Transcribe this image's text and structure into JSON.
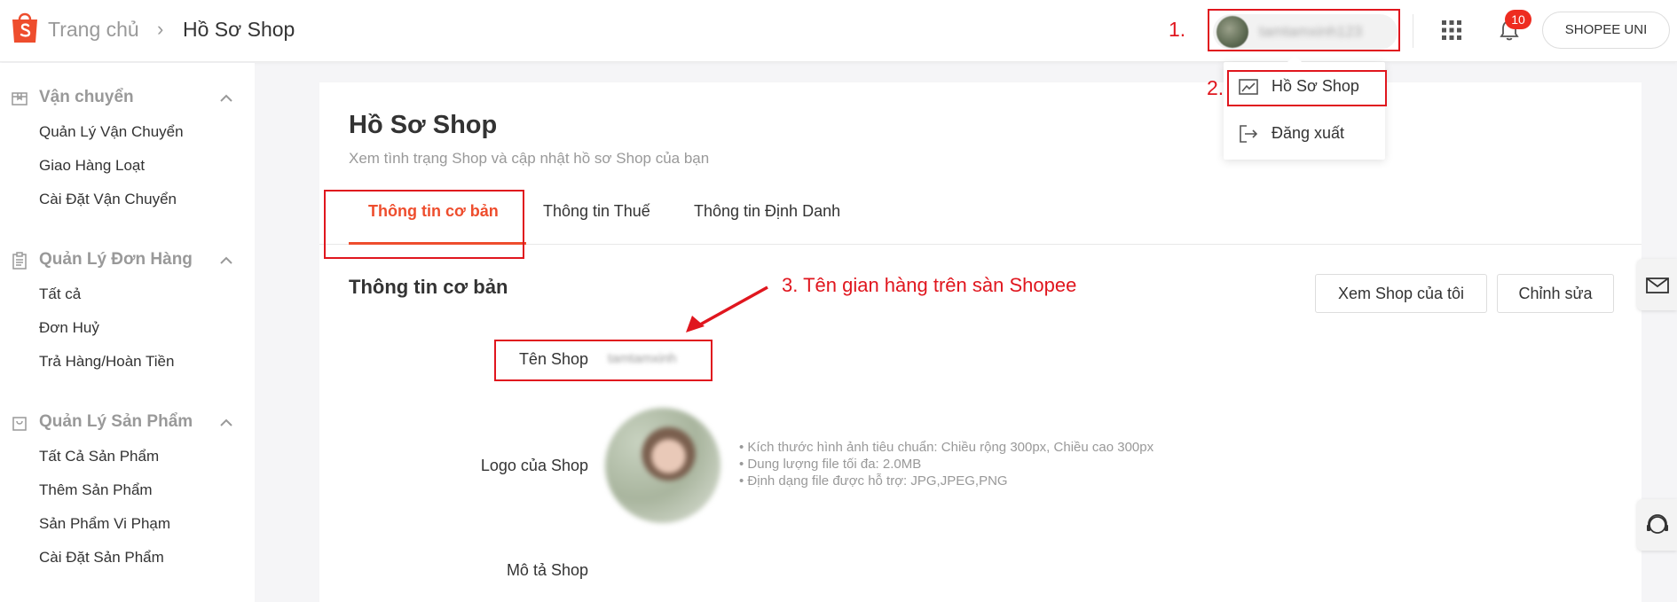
{
  "header": {
    "breadcrumb_home": "Trang chủ",
    "breadcrumb_separator": "›",
    "breadcrumb_current": "Hồ Sơ Shop",
    "user_name": "tamtamxinh123",
    "notification_count": "10",
    "uni_button": "SHOPEE UNI"
  },
  "user_menu": {
    "items": [
      {
        "label": "Hồ Sơ Shop",
        "icon": "shop-profile-icon"
      },
      {
        "label": "Đăng xuất",
        "icon": "logout-icon"
      }
    ]
  },
  "sidebar": {
    "sections": [
      {
        "title": "Vận chuyển",
        "icon": "shipping-box-icon",
        "items": [
          "Quản Lý Vận Chuyển",
          "Giao Hàng Loạt",
          "Cài Đặt Vận Chuyển"
        ]
      },
      {
        "title": "Quản Lý Đơn Hàng",
        "icon": "clipboard-icon",
        "items": [
          "Tất cả",
          "Đơn Huỷ",
          "Trả Hàng/Hoàn Tiền"
        ]
      },
      {
        "title": "Quản Lý Sản Phẩm",
        "icon": "bag-icon",
        "items": [
          "Tất Cả Sản Phẩm",
          "Thêm Sản Phẩm",
          "Sản Phẩm Vi Phạm",
          "Cài Đặt Sản Phẩm"
        ]
      }
    ]
  },
  "main": {
    "title": "Hồ Sơ Shop",
    "subtitle": "Xem tình trạng Shop và cập nhật hồ sơ Shop của bạn",
    "tabs": [
      {
        "label": "Thông tin cơ bản",
        "active": true
      },
      {
        "label": "Thông tin Thuế",
        "active": false
      },
      {
        "label": "Thông tin Định Danh",
        "active": false
      }
    ],
    "section_title": "Thông tin cơ bản",
    "view_shop_button": "Xem Shop của tôi",
    "edit_button": "Chỉnh sửa",
    "fields": {
      "shop_name_label": "Tên Shop",
      "shop_name_value": "tamtamxinh",
      "logo_label": "Logo của Shop",
      "logo_hints": [
        "• Kích thước hình ảnh tiêu chuẩn: Chiều rộng 300px, Chiều cao 300px",
        "• Dung lượng file tối đa: 2.0MB",
        "• Định dạng file được hỗ trợ: JPG,JPEG,PNG"
      ],
      "description_label": "Mô tả Shop"
    }
  },
  "annotations": {
    "step1": "1.",
    "step2": "2.",
    "step3": "3. Tên gian hàng trên sàn Shopee"
  },
  "colors": {
    "brand": "#ee4d2d",
    "annotation_red": "#e0161e",
    "badge": "#ee2c20"
  }
}
